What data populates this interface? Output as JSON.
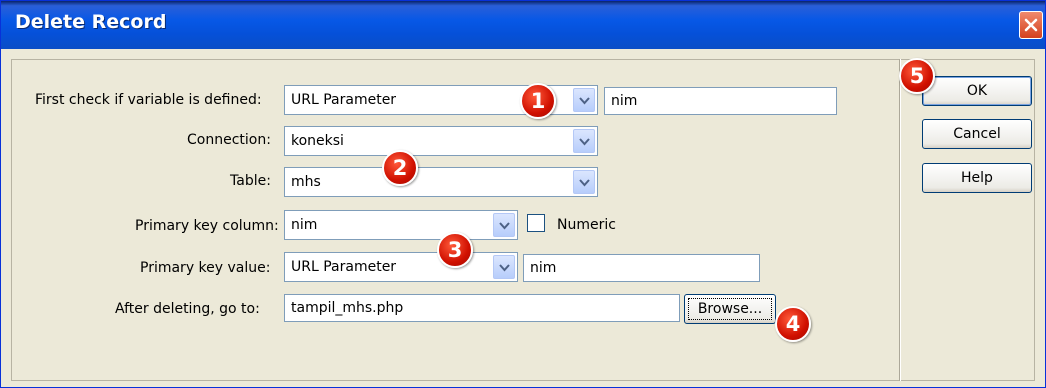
{
  "window": {
    "title": "Delete Record"
  },
  "form": {
    "first_check": {
      "label": "First check if variable is defined:",
      "type_value": "URL Parameter",
      "name_value": "nim"
    },
    "connection": {
      "label": "Connection:",
      "value": "koneksi"
    },
    "table": {
      "label": "Table:",
      "value": "mhs"
    },
    "primary_key_column": {
      "label": "Primary key column:",
      "value": "nim",
      "numeric_label": "Numeric",
      "numeric_checked": false
    },
    "primary_key_value": {
      "label": "Primary key value:",
      "type_value": "URL Parameter",
      "name_value": "nim"
    },
    "after_deleting": {
      "label": "After deleting, go to:",
      "value": "tampil_mhs.php",
      "browse_label": "Browse..."
    }
  },
  "buttons": {
    "ok": "OK",
    "cancel": "Cancel",
    "help": "Help"
  },
  "callouts": [
    "1",
    "2",
    "3",
    "4",
    "5"
  ],
  "colors": {
    "titlebar": "#0550d8",
    "dialog_bg": "#ece9d8",
    "badge": "#d01000",
    "close": "#d4401e"
  }
}
